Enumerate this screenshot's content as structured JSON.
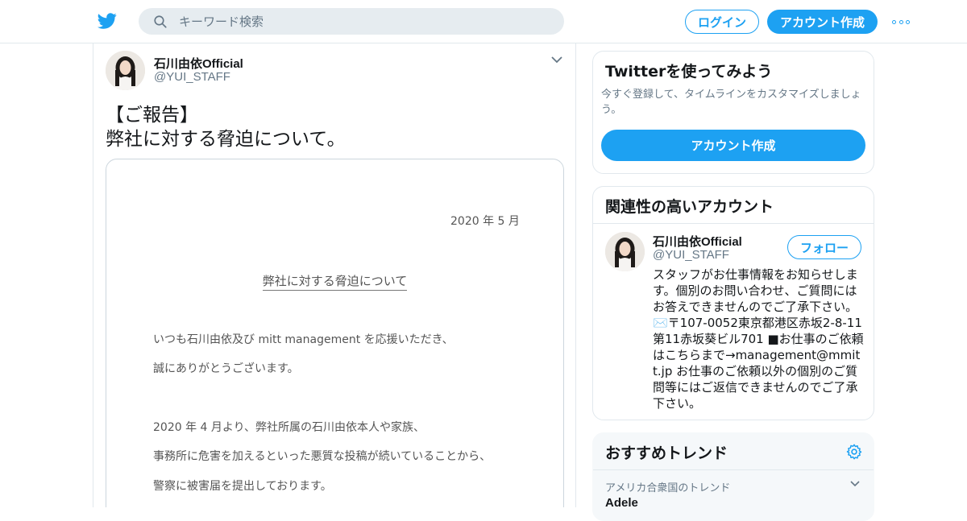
{
  "header": {
    "logo_icon": "twitter-bird-icon",
    "search_placeholder": "キーワード検索",
    "login_label": "ログイン",
    "signup_label": "アカウント作成",
    "accent_color": "#1da1f2"
  },
  "tweet": {
    "author_name": "石川由依Official",
    "author_handle": "@YUI_STAFF",
    "text_lines": [
      "【ご報告】",
      "弊社に対する脅迫について。"
    ],
    "attachment": {
      "date": "2020 年 5 月",
      "title": "弊社に対する脅迫について",
      "lines": [
        "いつも石川由依及び mitt management を応援いただき、",
        "誠にありがとうございます。",
        "2020 年 4 月より、弊社所属の石川由依本人や家族、",
        "事務所に危害を加えるといった悪質な投稿が続いていることから、",
        "警察に被害届を提出しております。"
      ]
    }
  },
  "sidebar": {
    "signup_card": {
      "title": "Twitterを使ってみよう",
      "subtitle": "今すぐ登録して、タイムラインをカスタマイズしましょう。",
      "button_label": "アカウント作成"
    },
    "related": {
      "title": "関連性の高いアカウント",
      "name": "石川由依Official",
      "handle": "@YUI_STAFF",
      "follow_label": "フォロー",
      "bio": "スタッフがお仕事情報をお知らせします。個別のお問い合わせ、ご質問にはお答えできませんのでご了承下さい。✉️〒107-0052東京都港区赤坂2-8-11 第11赤坂葵ビル701 ■お仕事のご依頼はこちらまで→management@mmitt.jp お仕事のご依頼以外の個別のご質問等にはご返信できませんのでご了承下さい。"
    },
    "trends": {
      "title": "おすすめトレンド",
      "context": "アメリカ合衆国のトレンド",
      "trend_name": "Adele"
    }
  }
}
